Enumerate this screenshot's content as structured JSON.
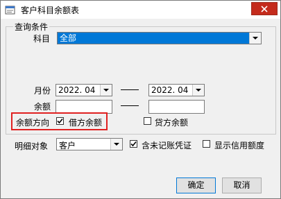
{
  "window": {
    "title": "客户科目余额表"
  },
  "query_group": {
    "label": "查询条件"
  },
  "subject": {
    "label": "科目",
    "value": "全部"
  },
  "month": {
    "label": "月份",
    "from": "2022. 04",
    "to": "2022. 04"
  },
  "balance": {
    "label": "余额"
  },
  "direction": {
    "label": "余额方向",
    "debit_label": "借方余额",
    "debit_checked": true,
    "credit_label": "贷方余额",
    "credit_checked": false
  },
  "detail": {
    "label": "明细对象",
    "value": "客户"
  },
  "include_unposted": {
    "label": "含未记账凭证",
    "checked": true
  },
  "show_credit_limit": {
    "label": "显示信用额度",
    "checked": false
  },
  "buttons": {
    "ok": "确定",
    "cancel": "取消"
  },
  "colors": {
    "highlight": "#e02020",
    "selection": "#0078d7",
    "close_button": "#c42b1c"
  }
}
